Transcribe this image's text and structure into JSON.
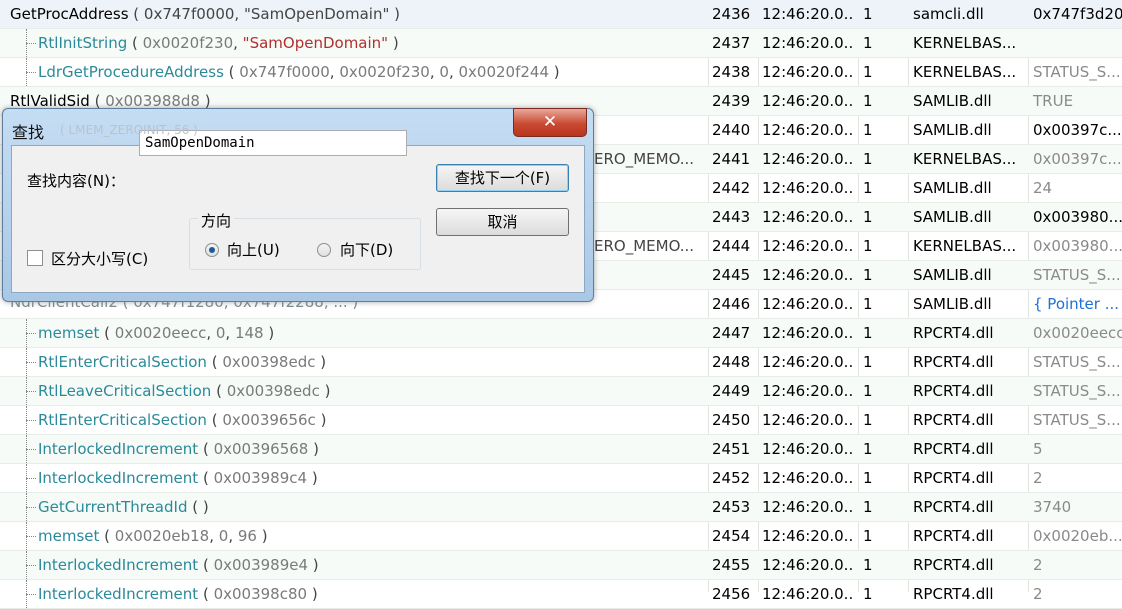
{
  "rows": [
    {
      "indent": 0,
      "fn": "GetProcAddress",
      "args": [
        {
          "t": "0x747f0000",
          "k": "d"
        },
        {
          "t": "\"SamOpenDomain\"",
          "k": "d"
        }
      ],
      "seq": "2436",
      "time": "12:46:20.0...",
      "thread": "1",
      "module": "samcli.dll",
      "ret": "0x747f3d20",
      "retc": "d",
      "sel": true
    },
    {
      "indent": 1,
      "fn": "RtlInitString",
      "args": [
        {
          "t": "0x0020f230",
          "k": "v"
        },
        {
          "t": "\"SamOpenDomain\"",
          "k": "s"
        }
      ],
      "seq": "2437",
      "time": "12:46:20.0...",
      "thread": "1",
      "module": "KERNELBAS...",
      "ret": "",
      "retc": "d"
    },
    {
      "indent": 1,
      "fn": "LdrGetProcedureAddress",
      "args": [
        {
          "t": "0x747f0000",
          "k": "v"
        },
        {
          "t": "0x0020f230",
          "k": "v"
        },
        {
          "t": "0",
          "k": "v"
        },
        {
          "t": "0x0020f244",
          "k": "v"
        }
      ],
      "seq": "2438",
      "time": "12:46:20.0...",
      "thread": "1",
      "module": "KERNELBAS...",
      "ret": "STATUS_S...",
      "retc": "g"
    },
    {
      "indent": 0,
      "fn": "RtlValidSid",
      "args": [
        {
          "t": "0x003988d8",
          "k": "v"
        }
      ],
      "seq": "2439",
      "time": "12:46:20.0...",
      "thread": "1",
      "module": "SAMLIB.dll",
      "ret": "TRUE",
      "retc": "g"
    },
    {
      "indent": 0,
      "fn": "",
      "args": [],
      "seq": "2440",
      "time": "12:46:20.0...",
      "thread": "1",
      "module": "SAMLIB.dll",
      "ret": "0x00397c...",
      "retc": "d"
    },
    {
      "indent": 0,
      "fn": "",
      "args": [],
      "tail": "ERO_MEMO...",
      "seq": "2441",
      "time": "12:46:20.0...",
      "thread": "1",
      "module": "KERNELBAS...",
      "ret": "0x00397c...",
      "retc": "g"
    },
    {
      "indent": 0,
      "fn": "",
      "args": [],
      "seq": "2442",
      "time": "12:46:20.0...",
      "thread": "1",
      "module": "SAMLIB.dll",
      "ret": "24",
      "retc": "g"
    },
    {
      "indent": 0,
      "fn": "",
      "args": [],
      "seq": "2443",
      "time": "12:46:20.0...",
      "thread": "1",
      "module": "SAMLIB.dll",
      "ret": "0x003980...",
      "retc": "d"
    },
    {
      "indent": 0,
      "fn": "",
      "args": [],
      "tail": "ERO_MEMO...",
      "seq": "2444",
      "time": "12:46:20.0...",
      "thread": "1",
      "module": "KERNELBAS...",
      "ret": "0x003980...",
      "retc": "g"
    },
    {
      "indent": 0,
      "fn": "",
      "args": [],
      "seq": "2445",
      "time": "12:46:20.0...",
      "thread": "1",
      "module": "SAMLIB.dll",
      "ret": "STATUS_S...",
      "retc": "g"
    },
    {
      "indent": 0,
      "fn": "",
      "args": [],
      "seq": "2446",
      "time": "12:46:20.0...",
      "thread": "1",
      "module": "SAMLIB.dll",
      "ret": "{ Pointer ...",
      "retc": "b"
    },
    {
      "indent": 1,
      "fn": "memset",
      "args": [
        {
          "t": "0x0020eecc",
          "k": "v"
        },
        {
          "t": "0",
          "k": "v"
        },
        {
          "t": "148",
          "k": "v"
        }
      ],
      "seq": "2447",
      "time": "12:46:20.0...",
      "thread": "1",
      "module": "RPCRT4.dll",
      "ret": "0x0020eecc",
      "retc": "g"
    },
    {
      "indent": 1,
      "fn": "RtlEnterCriticalSection",
      "args": [
        {
          "t": "0x00398edc",
          "k": "v"
        }
      ],
      "seq": "2448",
      "time": "12:46:20.0...",
      "thread": "1",
      "module": "RPCRT4.dll",
      "ret": "STATUS_S...",
      "retc": "g"
    },
    {
      "indent": 1,
      "fn": "RtlLeaveCriticalSection",
      "args": [
        {
          "t": "0x00398edc",
          "k": "v"
        }
      ],
      "seq": "2449",
      "time": "12:46:20.0...",
      "thread": "1",
      "module": "RPCRT4.dll",
      "ret": "STATUS_S...",
      "retc": "g"
    },
    {
      "indent": 1,
      "fn": "RtlEnterCriticalSection",
      "args": [
        {
          "t": "0x0039656c",
          "k": "v"
        }
      ],
      "seq": "2450",
      "time": "12:46:20.0...",
      "thread": "1",
      "module": "RPCRT4.dll",
      "ret": "STATUS_S...",
      "retc": "g"
    },
    {
      "indent": 1,
      "fn": "InterlockedIncrement",
      "args": [
        {
          "t": "0x00396568",
          "k": "v"
        }
      ],
      "seq": "2451",
      "time": "12:46:20.0...",
      "thread": "1",
      "module": "RPCRT4.dll",
      "ret": "5",
      "retc": "g"
    },
    {
      "indent": 1,
      "fn": "InterlockedIncrement",
      "args": [
        {
          "t": "0x003989c4",
          "k": "v"
        }
      ],
      "seq": "2452",
      "time": "12:46:20.0...",
      "thread": "1",
      "module": "RPCRT4.dll",
      "ret": "2",
      "retc": "g"
    },
    {
      "indent": 1,
      "fn": "GetCurrentThreadId",
      "args": [],
      "seq": "2453",
      "time": "12:46:20.0...",
      "thread": "1",
      "module": "RPCRT4.dll",
      "ret": "3740",
      "retc": "g"
    },
    {
      "indent": 1,
      "fn": "memset",
      "args": [
        {
          "t": "0x0020eb18",
          "k": "v"
        },
        {
          "t": "0",
          "k": "v"
        },
        {
          "t": "96",
          "k": "v"
        }
      ],
      "seq": "2454",
      "time": "12:46:20.0...",
      "thread": "1",
      "module": "RPCRT4.dll",
      "ret": "0x0020eb...",
      "retc": "g"
    },
    {
      "indent": 1,
      "fn": "InterlockedIncrement",
      "args": [
        {
          "t": "0x003989e4",
          "k": "v"
        }
      ],
      "seq": "2455",
      "time": "12:46:20.0...",
      "thread": "1",
      "module": "RPCRT4.dll",
      "ret": "2",
      "retc": "g"
    },
    {
      "indent": 1,
      "fn": "InterlockedIncrement",
      "args": [
        {
          "t": "0x00398c80",
          "k": "v"
        }
      ],
      "seq": "2456",
      "time": "12:46:20.0...",
      "thread": "1",
      "module": "RPCRT4.dll",
      "ret": "2",
      "retc": "g"
    }
  ],
  "hidden_row_fragments": {
    "r2440": "( LMEM_ZEROINIT, 56 )",
    "r2446": "NdrClientCall2 ( 0x747f1280, 0x747f2288, ... )"
  },
  "dialog": {
    "title": "查找",
    "close_glyph": "✕",
    "find_label": "查找内容(N)：",
    "find_value": "SamOpenDomain",
    "find_next_label": "查找下一个(F)",
    "cancel_label": "取消",
    "direction_label": "方向",
    "up_label": "向上(U)",
    "down_label": "向下(D)",
    "match_case_label": "区分大小写(C)",
    "direction_selected": "up",
    "match_case_checked": false
  }
}
